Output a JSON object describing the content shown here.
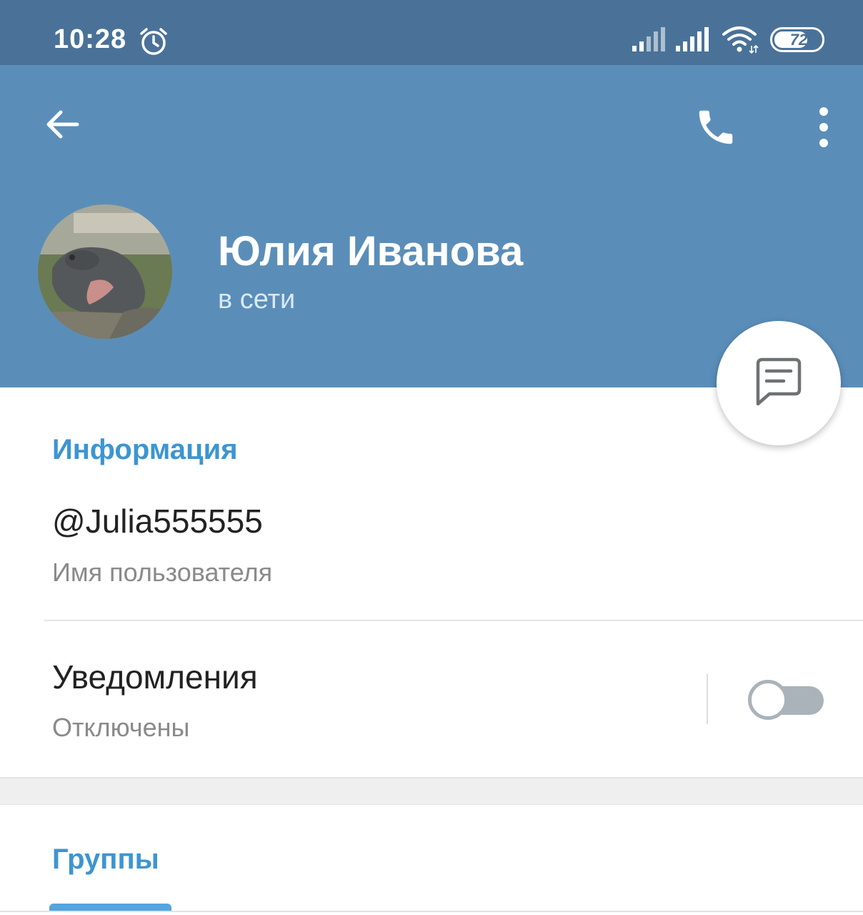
{
  "status_bar": {
    "time": "10:28",
    "battery_level": "72",
    "battery_percent": 72,
    "icons": [
      "alarm-icon",
      "signal-icon",
      "signal-icon",
      "wifi-icon",
      "battery-icon"
    ]
  },
  "toolbar": {
    "back_icon": "arrow-left-icon",
    "call_icon": "phone-icon",
    "more_icon": "more-vertical-icon"
  },
  "profile": {
    "name": "Юлия Иванова",
    "status": "в сети",
    "avatar": "photo of a hippopotamus"
  },
  "fab": {
    "icon": "message-icon"
  },
  "info_section": {
    "title": "Информация",
    "username": "@Julia555555",
    "username_label": "Имя пользователя",
    "notifications_label": "Уведомления",
    "notifications_state": "Отключены",
    "notifications_enabled": false
  },
  "groups_section": {
    "title": "Группы"
  },
  "colors": {
    "status_bar": "#4a7298",
    "header": "#5a8eb9",
    "accent": "#3d95d1",
    "toggle_off": "#a9b3b9"
  }
}
